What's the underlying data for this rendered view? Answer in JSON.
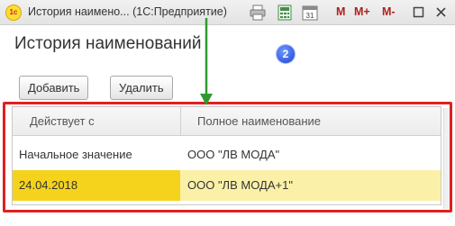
{
  "window": {
    "app_logo_text": "1c",
    "title": "История наимено... (1С:Предприятие)",
    "icons": [
      "printer-icon",
      "calculator-icon",
      "calendar-icon"
    ],
    "calendar_day": "31",
    "memory_buttons": [
      "M",
      "M+",
      "M-"
    ],
    "window_controls": [
      "restore",
      "close"
    ]
  },
  "form": {
    "title": "История наименований",
    "annotation_number": "2",
    "add_button": "Добавить",
    "delete_button": "Удалить"
  },
  "table": {
    "columns": [
      "Действует с",
      "Полное наименование"
    ],
    "rows": [
      {
        "date": "Начальное значение",
        "name": "ООО \"ЛВ МОДА\""
      },
      {
        "date": "24.04.2018",
        "name": "ООО \"ЛВ МОДА+1\""
      }
    ],
    "selected_row": 1
  },
  "colors": {
    "highlight_frame": "#e02020",
    "arrow": "#2e9a2e",
    "selection_primary": "#f5d21c",
    "selection_secondary": "#fbf0a8",
    "badge": "#1c3fce"
  }
}
